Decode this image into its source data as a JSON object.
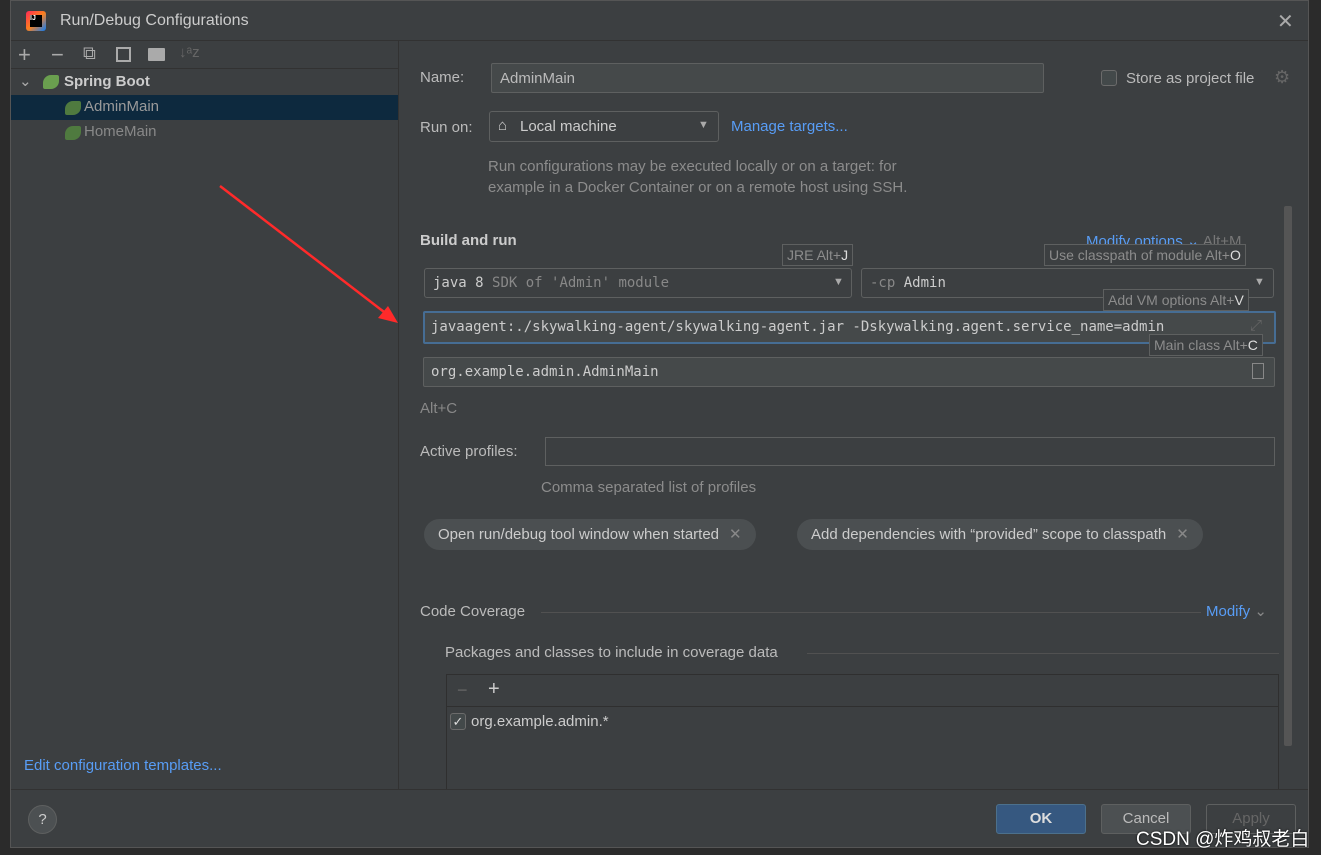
{
  "window": {
    "title": "Run/Debug Configurations"
  },
  "toolbar": {
    "add": "+",
    "remove": "−",
    "copy": "⧉",
    "save": "💾",
    "folder": "📁",
    "sort": "↓ᵃz"
  },
  "tree": {
    "group": "Spring Boot",
    "items": [
      {
        "label": "AdminMain",
        "selected": true
      },
      {
        "label": "HomeMain",
        "selected": false
      }
    ]
  },
  "left_footer": {
    "edit_templates": "Edit configuration templates..."
  },
  "form": {
    "name_label": "Name:",
    "name_value": "AdminMain",
    "store_label": "Store as project file",
    "store_checked": false,
    "run_on_label": "Run on:",
    "run_on_value": "Local machine",
    "manage_targets": "Manage targets...",
    "run_on_help_1": "Run configurations may be executed locally or on a target: for",
    "run_on_help_2": "example in a Docker Container or on a remote host using SSH.",
    "build_and_run": "Build and run",
    "modify_options": "Modify options",
    "modify_options_shortcut": "Alt+M",
    "jre_prefix": "java 8",
    "jre_value": "SDK of 'Admin' module",
    "cp_prefix": "-cp",
    "cp_value": "Admin",
    "vm_options": "javaagent:./skywalking-agent/skywalking-agent.jar -Dskywalking.agent.service_name=admin",
    "main_class": "org.example.admin.AdminMain",
    "alt_c": "Alt+C",
    "active_profiles_label": "Active profiles:",
    "active_profiles_value": "",
    "profiles_help": "Comma separated list of profiles",
    "chips": [
      "Open run/debug tool window when started",
      "Add dependencies with “provided” scope to classpath"
    ],
    "code_coverage": "Code Coverage",
    "modify": "Modify",
    "packages_label": "Packages and classes to include in coverage data",
    "coverage_items": [
      {
        "label": "org.example.admin.*",
        "checked": true
      }
    ]
  },
  "hints": {
    "jre": {
      "text": "JRE Alt+",
      "key": "J"
    },
    "classpath": {
      "text": "Use classpath of module Alt+",
      "key": "O"
    },
    "vm": {
      "text": "Add VM options Alt+",
      "key": "V"
    },
    "main": {
      "text": "Main class Alt+",
      "key": "C"
    }
  },
  "buttons": {
    "ok": "OK",
    "cancel": "Cancel",
    "apply": "Apply",
    "help": "?"
  },
  "watermark": "CSDN @炸鸡叔老白",
  "colors": {
    "accent": "#589df6",
    "selection": "#0d293e",
    "ok": "#365880",
    "arrow": "#ff2a2a"
  }
}
